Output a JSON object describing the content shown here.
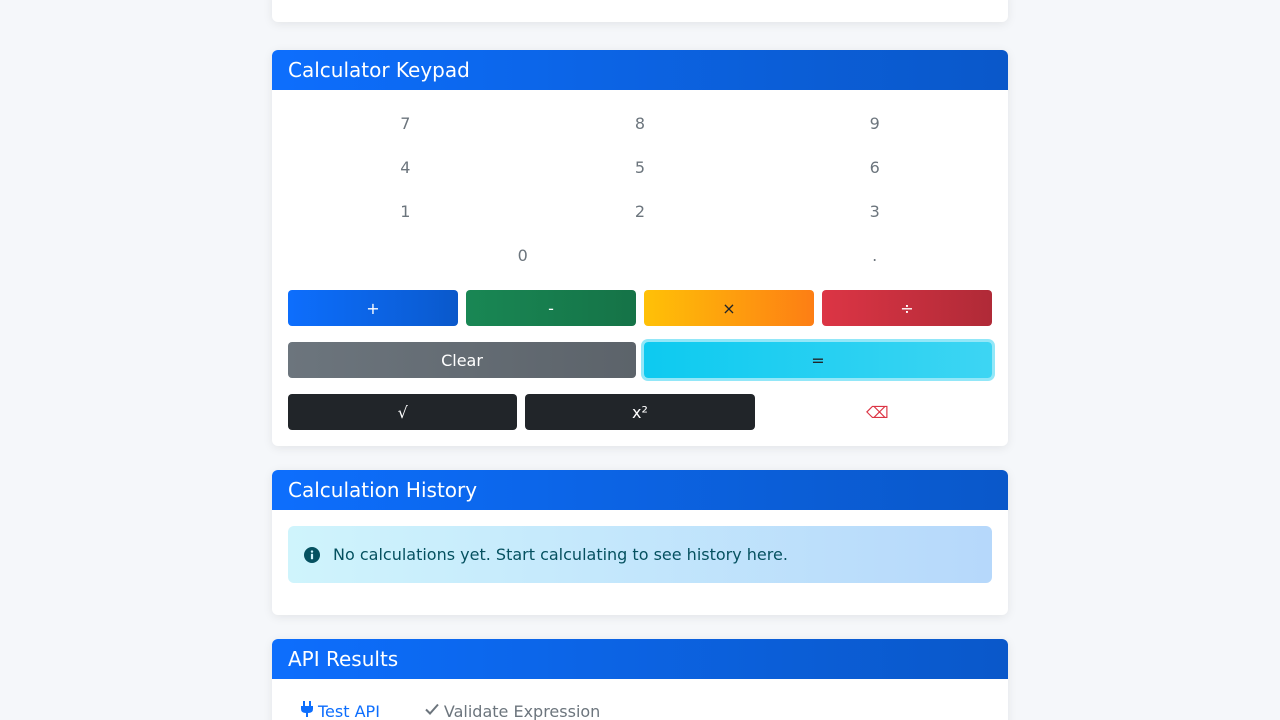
{
  "keypad": {
    "title": "Calculator Keypad",
    "digits": {
      "row1": [
        "7",
        "8",
        "9"
      ],
      "row2": [
        "4",
        "5",
        "6"
      ],
      "row3": [
        "1",
        "2",
        "3"
      ],
      "row4": [
        "0",
        "."
      ]
    },
    "operators": {
      "plus": "+",
      "minus": "-",
      "multiply": "×",
      "divide": "÷"
    },
    "clear_label": "Clear",
    "equals_label": "=",
    "sqrt_label": "√",
    "square_label": "x²",
    "backspace_label": "⌫"
  },
  "history": {
    "title": "Calculation History",
    "empty_message": "No calculations yet. Start calculating to see history here."
  },
  "api": {
    "title": "API Results",
    "tabs": [
      {
        "label": "Test API",
        "icon": "plug-icon",
        "active": true
      },
      {
        "label": "Validate Expression",
        "icon": "check-icon",
        "active": false
      }
    ]
  },
  "colors": {
    "primary": "#0d6efd",
    "success": "#198754",
    "warning": "#ffc107",
    "danger": "#dc3545",
    "secondary": "#6c757d",
    "info": "#0dcaf0",
    "dark": "#212529"
  }
}
